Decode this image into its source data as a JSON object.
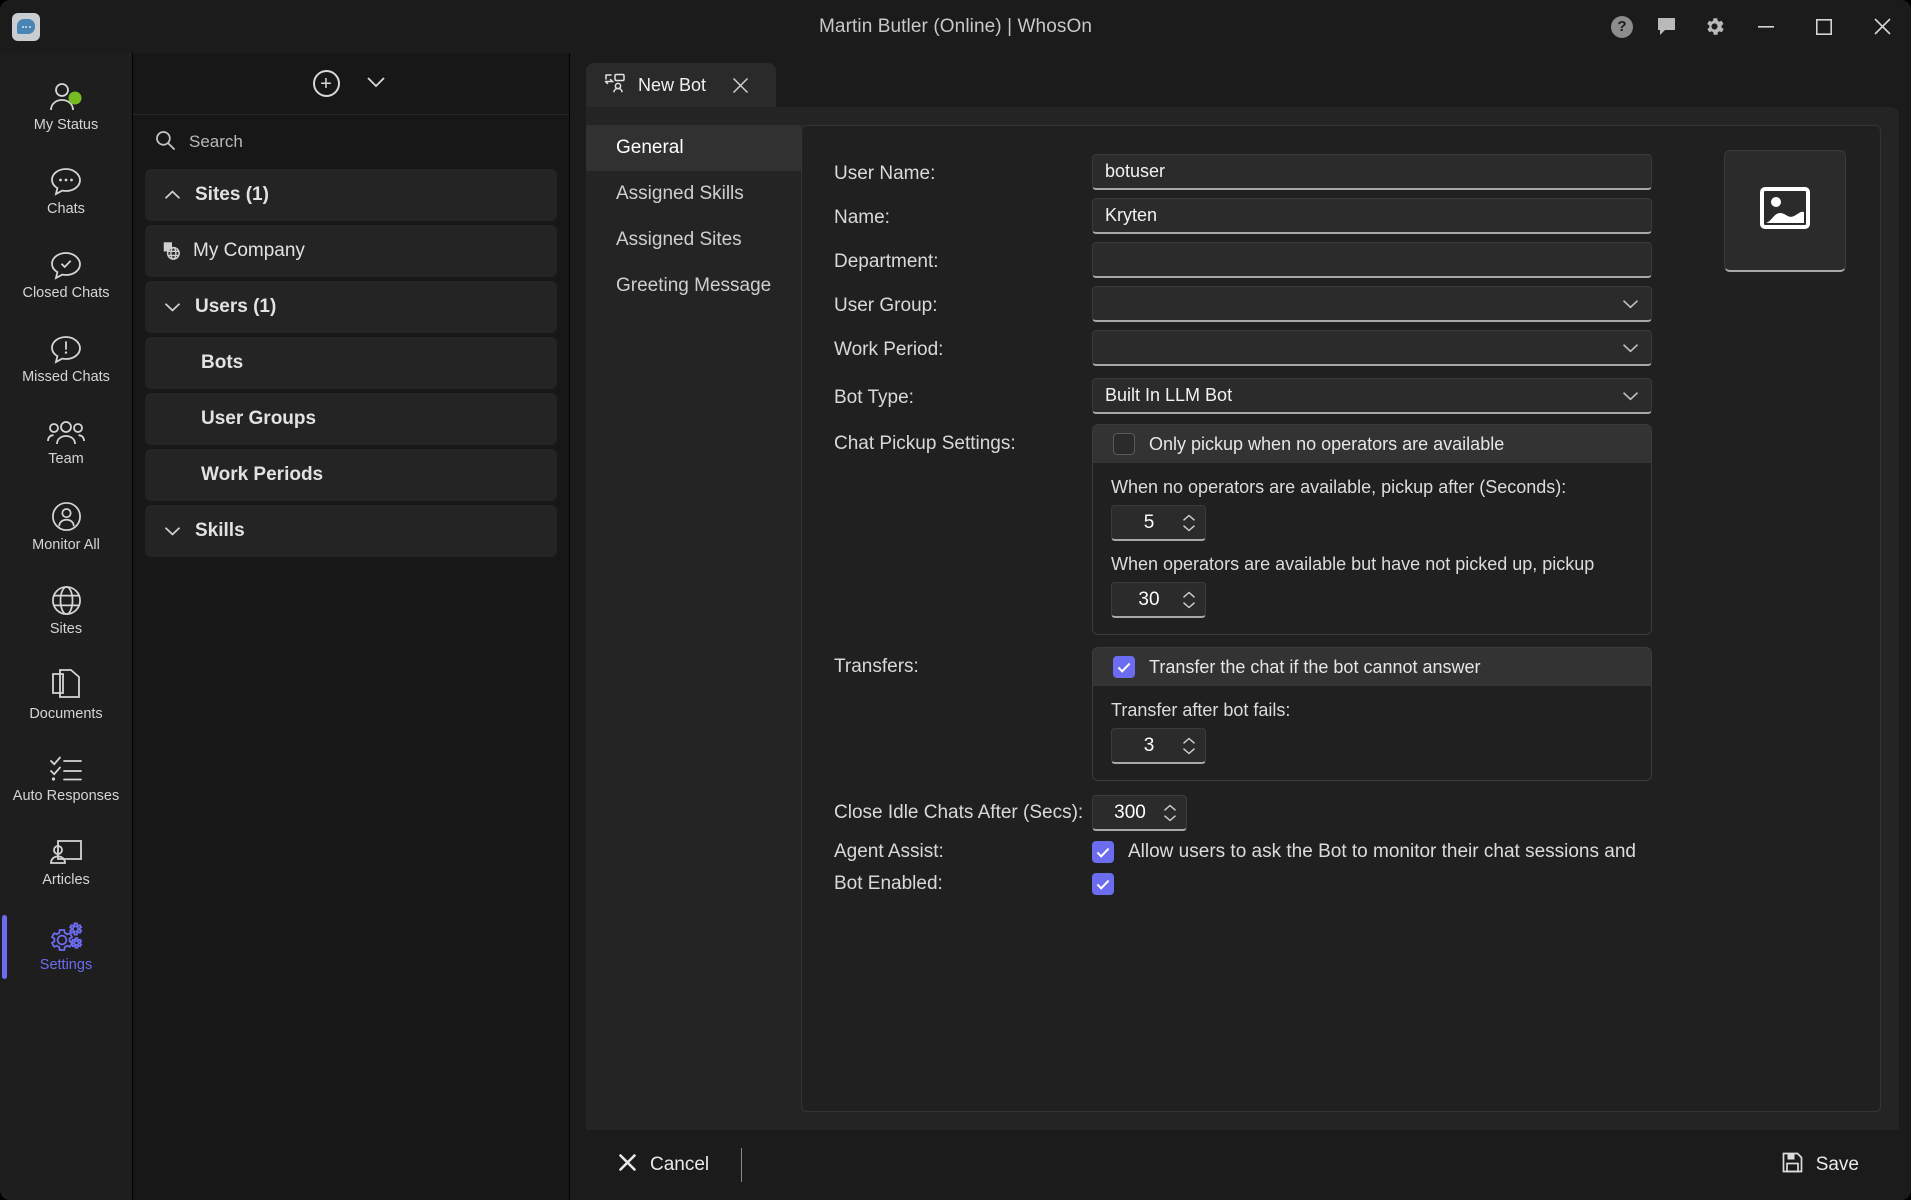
{
  "window": {
    "title": "Martin Butler (Online)  | WhosOn",
    "logo_icon": "chat-bubble-app-logo",
    "actions": [
      {
        "name": "help-icon",
        "glyph": "?"
      },
      {
        "name": "feedback-icon",
        "glyph": "speech-bubble"
      },
      {
        "name": "settings-gear-icon",
        "glyph": "gear"
      },
      {
        "name": "minimize-button",
        "glyph": "minimize"
      },
      {
        "name": "maximize-button",
        "glyph": "maximize"
      },
      {
        "name": "close-button",
        "glyph": "close"
      }
    ]
  },
  "rail": {
    "items": [
      {
        "label": "My Status",
        "icon": "user-status-icon",
        "active": false
      },
      {
        "label": "Chats",
        "icon": "chat-bubble-icon",
        "active": false
      },
      {
        "label": "Closed Chats",
        "icon": "chat-check-icon",
        "active": false
      },
      {
        "label": "Missed Chats",
        "icon": "chat-alert-icon",
        "active": false
      },
      {
        "label": "Team",
        "icon": "people-group-icon",
        "active": false
      },
      {
        "label": "Monitor All",
        "icon": "user-circle-icon",
        "active": false
      },
      {
        "label": "Sites",
        "icon": "globe-icon",
        "active": false
      },
      {
        "label": "Documents",
        "icon": "documents-icon",
        "active": false
      },
      {
        "label": "Auto Responses",
        "icon": "checklist-icon",
        "active": false
      },
      {
        "label": "Articles",
        "icon": "article-presenter-icon",
        "active": false
      },
      {
        "label": "Settings",
        "icon": "gears-icon",
        "active": true
      }
    ]
  },
  "tree_panel": {
    "toolbar": {
      "add_icon": "plus-circle-icon",
      "dropdown_icon": "chevron-down-icon"
    },
    "search": {
      "icon": "search-icon",
      "placeholder": "Search",
      "value": ""
    },
    "nodes": [
      {
        "label": "Sites (1)",
        "type": "group",
        "caret": "chevron-up-icon",
        "indent": 0
      },
      {
        "label": "My Company",
        "type": "leaf",
        "icon": "site-globe-icon",
        "indent": 0
      },
      {
        "label": "Users (1)",
        "type": "group",
        "caret": "chevron-down-icon",
        "indent": 0
      },
      {
        "label": "Bots",
        "type": "child",
        "indent": 1
      },
      {
        "label": "User Groups",
        "type": "child",
        "indent": 1
      },
      {
        "label": "Work Periods",
        "type": "child",
        "indent": 1
      },
      {
        "label": "Skills",
        "type": "group",
        "caret": "chevron-down-icon",
        "indent": 0
      }
    ]
  },
  "tab": {
    "label": "New Bot",
    "icon": "bot-user-icon",
    "close_icon": "close-icon"
  },
  "subnav": {
    "items": [
      {
        "label": "General",
        "active": true
      },
      {
        "label": "Assigned Skills",
        "active": false
      },
      {
        "label": "Assigned Sites",
        "active": false
      },
      {
        "label": "Greeting Message",
        "active": false
      }
    ]
  },
  "form": {
    "user_name": {
      "label": "User Name:",
      "value": "botuser",
      "placeholder": ""
    },
    "name": {
      "label": "Name:",
      "value": "Kryten",
      "placeholder": ""
    },
    "department": {
      "label": "Department:",
      "value": "",
      "placeholder": ""
    },
    "user_group": {
      "label": "User Group:",
      "value": "",
      "chevron": "chevron-down-icon"
    },
    "work_period": {
      "label": "Work Period:",
      "value": "",
      "chevron": "chevron-down-icon"
    },
    "bot_type": {
      "label": "Bot Type:",
      "value": "Built In LLM Bot",
      "chevron": "chevron-down-icon"
    },
    "chat_pickup": {
      "label": "Chat Pickup Settings:",
      "header_checkbox_label": "Only pickup when no operators are available",
      "header_checked": false,
      "caption_1": "When no operators are available, pickup after (Seconds):",
      "value_1": "5",
      "caption_2": "When operators are available but have not picked up, pickup",
      "value_2": "30"
    },
    "transfers": {
      "label": "Transfers:",
      "header_checkbox_label": "Transfer the chat if the bot cannot answer",
      "header_checked": true,
      "caption": "Transfer after bot fails:",
      "value": "3"
    },
    "close_idle": {
      "label": "Close Idle Chats After (Secs):",
      "value": "300"
    },
    "agent_assist": {
      "label": "Agent Assist:",
      "checkbox_label": "Allow users to ask the Bot to monitor their chat sessions and",
      "checked": true
    },
    "bot_enabled": {
      "label": "Bot Enabled:",
      "checked": true
    },
    "avatar": {
      "icon": "image-placeholder-icon"
    }
  },
  "footer": {
    "cancel_label": "Cancel",
    "cancel_icon": "close-x-icon",
    "save_label": "Save",
    "save_icon": "floppy-save-icon"
  },
  "colors": {
    "accent": "#6c6cf0",
    "online_status": "#76bc21",
    "window_bg": "#1b1b1b",
    "panel_bg": "#242424"
  }
}
